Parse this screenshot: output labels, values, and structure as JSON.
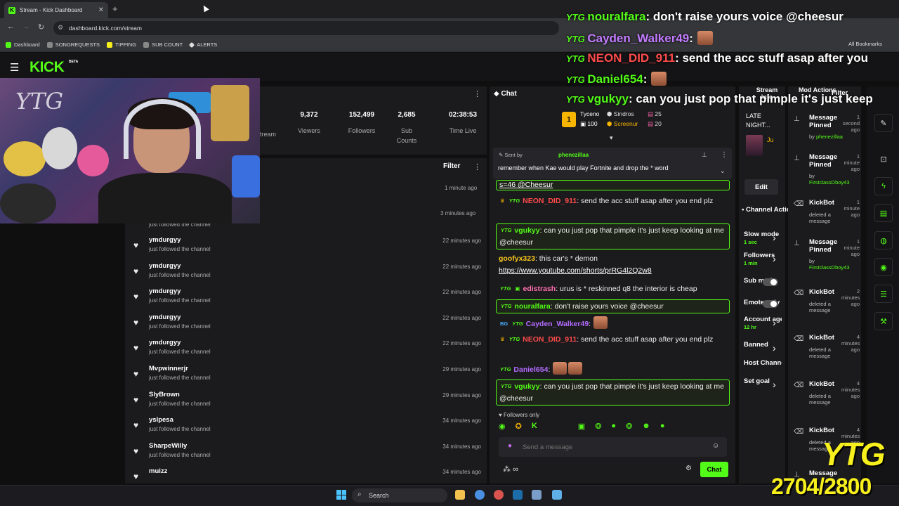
{
  "browser": {
    "tab_title": "Stream - Kick Dashboard",
    "url": "dashboard.kick.com/stream",
    "bookmarks": [
      "Dashboard",
      "SONGREQUESTS",
      "TIPPING",
      "SUB COUNT",
      "ALERTS"
    ],
    "all_bookmarks": "All Bookmarks"
  },
  "header": {
    "logo": "KICK",
    "beta": "BETA"
  },
  "webcam": {
    "overlay_text": "YTG"
  },
  "stats": {
    "stream_label": "tream",
    "items": [
      {
        "value": "9,372",
        "label": "Viewers"
      },
      {
        "value": "152,499",
        "label": "Followers"
      },
      {
        "value": "2,685",
        "label": "Sub Counts"
      },
      {
        "value": "02:38:53",
        "label": "Time Live"
      }
    ]
  },
  "feed": {
    "filter_label": "Filter",
    "first_times": [
      "1 minute ago",
      "3 minutes ago"
    ],
    "first_partial_action": "just followed the channel",
    "rows": [
      {
        "name": "ymdurgyy",
        "action": "just followed the channel",
        "time": "22 minutes ago"
      },
      {
        "name": "ymdurgyy",
        "action": "just followed the channel",
        "time": "22 minutes ago"
      },
      {
        "name": "ymdurgyy",
        "action": "just followed the channel",
        "time": "22 minutes ago"
      },
      {
        "name": "ymdurgyy",
        "action": "just followed the channel",
        "time": "22 minutes ago"
      },
      {
        "name": "ymdurgyy",
        "action": "just followed the channel",
        "time": "22 minutes ago"
      },
      {
        "name": "Mvpwinnerjr",
        "action": "just followed the channel",
        "time": "29 minutes ago"
      },
      {
        "name": "SlyBrown",
        "action": "just followed the channel",
        "time": "29 minutes ago"
      },
      {
        "name": "yslpesa",
        "action": "just followed the channel",
        "time": "34 minutes ago"
      },
      {
        "name": "SharpeWilly",
        "action": "just followed the channel",
        "time": "34 minutes ago"
      },
      {
        "name": "muizz",
        "action": "",
        "time": "34 minutes ago"
      }
    ]
  },
  "chat": {
    "title": "Chat",
    "leaderboard": [
      {
        "name": "Tyceno",
        "count": "100"
      },
      {
        "name": "Sindros",
        "count": "25"
      },
      {
        "name": "Screenur",
        "count": "20"
      }
    ],
    "leader_rank": "1",
    "pinned": {
      "sent_by": "Sent by",
      "user": "phenezillaa",
      "message": "remember when Kae would play Fortnite and drop the * word"
    },
    "partial_top": "s=46 @Cheesur",
    "messages": [
      {
        "badges": "crown-ytg",
        "user": "NEON_DID_911",
        "color": "#ff4b4b",
        "text": "send the acc stuff asap after you end plz",
        "hl": false
      },
      {
        "badges": "ytg",
        "user": "vgukyy",
        "color": "#53fc18",
        "text": "can you just pop that pimple it's just keep looking at me @cheesur",
        "hl": true
      },
      {
        "badges": "",
        "user": "goofyx323",
        "color": "#f7c51c",
        "text": "this car's * demon",
        "link": "https://www.youtube.com/shorts/prRG4l2Q2w8",
        "hl": false
      },
      {
        "badges": "ytg-sub",
        "user": "edistrash",
        "color": "#ff6fb1",
        "text": "urus is * reskinned q8 the interior is cheap",
        "hl": false
      },
      {
        "badges": "ytg",
        "user": "nouralfara",
        "color": "#53fc18",
        "text": "don't raise yours voice @cheesur",
        "hl": true
      },
      {
        "badges": "bg-ytg",
        "user": "Cayden_Walker49",
        "color": "#b36bff",
        "text": "",
        "hl": false
      },
      {
        "badges": "crown-ytg",
        "user": "NEON_DID_911",
        "color": "#ff4b4b",
        "text": "send the acc stuff asap after you end plz",
        "hl": false
      },
      {
        "badges": "ytg",
        "user": "Daniel654",
        "color": "#b36bff",
        "text": "",
        "hl": false
      },
      {
        "badges": "ytg",
        "user": "vgukyy",
        "color": "#53fc18",
        "text": "can you just pop that pimple it's just keep looking at me @cheesur",
        "hl": true
      }
    ],
    "followers_only": "Followers only",
    "input_placeholder": "Send a message",
    "send_label": "Chat",
    "infinity": "∞"
  },
  "stream_info": {
    "title": "Stream Info",
    "stream_title": "LATE NIGHT...",
    "edit_label": "Edit",
    "channel_actions_title": "Channel Actions",
    "actions": [
      {
        "label": "Slow mode",
        "sub": "1 sec",
        "control": "chevron"
      },
      {
        "label": "Followers",
        "sub": "1 min",
        "control": "chevron"
      },
      {
        "label": "Sub mode",
        "sub": "",
        "control": "toggle"
      },
      {
        "label": "Emote only",
        "sub": "",
        "control": "toggle"
      },
      {
        "label": "Account age",
        "sub": "12 hr",
        "control": "chevron"
      },
      {
        "label": "Banned",
        "sub": "",
        "control": "chevron"
      },
      {
        "label": "Host Channel",
        "sub": "",
        "control": "none"
      },
      {
        "label": "Set goal",
        "sub": "",
        "control": "chevron"
      }
    ]
  },
  "mod": {
    "title": "Mod Actions",
    "filter_label": "Filter",
    "rows": [
      {
        "icon": "pin",
        "title": "Message Pinned",
        "time": "1 second ago",
        "sub": "by",
        "user": "phenezillaa"
      },
      {
        "icon": "pin",
        "title": "Message Pinned",
        "time": "1 minute ago",
        "sub": "by",
        "user": "FirstclassDboy43"
      },
      {
        "icon": "trash",
        "title": "KickBot",
        "time": "1 minute ago",
        "sub": "deleted a message",
        "user": ""
      },
      {
        "icon": "pin",
        "title": "Message Pinned",
        "time": "1 minute ago",
        "sub": "by",
        "user": "FirstclassDboy43"
      },
      {
        "icon": "trash",
        "title": "KickBot",
        "time": "2 minutes ago",
        "sub": "deleted a message",
        "user": ""
      },
      {
        "icon": "trash",
        "title": "KickBot",
        "time": "4 minutes ago",
        "sub": "deleted a message",
        "user": ""
      },
      {
        "icon": "trash",
        "title": "KickBot",
        "time": "4 minutes ago",
        "sub": "deleted a message",
        "user": ""
      },
      {
        "icon": "trash",
        "title": "KickBot",
        "time": "4 minutes ago",
        "sub": "deleted a message",
        "user": ""
      },
      {
        "icon": "pin",
        "title": "Message",
        "time": "",
        "sub": "",
        "user": ""
      }
    ]
  },
  "overlay_chat": [
    {
      "user": "nouralfara",
      "color": "#53fc18",
      "text": "don't raise yours voice @cheesur"
    },
    {
      "user": "Cayden_Walker49",
      "color": "#c27bff",
      "text": ""
    },
    {
      "user": "NEON_DID_911",
      "color": "#ff4b4b",
      "text": "send the acc stuff asap after you"
    },
    {
      "user": "Daniel654",
      "color": "#53fc18",
      "text": ""
    },
    {
      "user": "vgukyy",
      "color": "#53fc18",
      "text": "can you just pop that pimple it's just keep"
    }
  ],
  "goal": {
    "brand": "YTG",
    "count": "2704/2800"
  },
  "taskbar": {
    "search_label": "Search"
  },
  "colors": {
    "accent": "#53fc18",
    "panel": "#1b1b1d"
  }
}
